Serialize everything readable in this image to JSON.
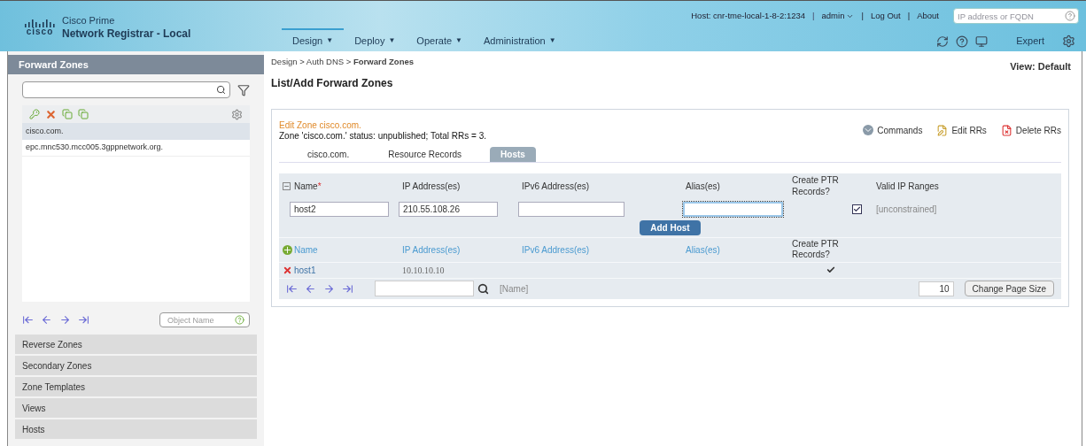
{
  "header": {
    "logo_word": "cisco",
    "product_line": "Cisco Prime",
    "product": "Network Registrar - Local",
    "host": "Host: cnr-tme-local-1-8-2:1234",
    "user": "admin",
    "logout": "Log Out",
    "about": "About",
    "search": {
      "placeholder": "IP address or FQDN"
    },
    "menu": [
      {
        "label": "Design",
        "selected": true
      },
      {
        "label": "Deploy",
        "selected": false
      },
      {
        "label": "Operate",
        "selected": false
      },
      {
        "label": "Administration",
        "selected": false
      }
    ],
    "mode": "Expert",
    "separator": "|",
    "menu_caret": "▼"
  },
  "sidebar": {
    "title": "Forward Zones",
    "zones": [
      {
        "label": "cisco.com.",
        "selected": true
      },
      {
        "label": "epc.mnc530.mcc005.3gppnetwork.org.",
        "selected": false
      }
    ],
    "object_search": {
      "placeholder": "Object Name"
    },
    "sections": [
      "Reverse Zones",
      "Secondary Zones",
      "Zone Templates",
      "Views",
      "Hosts"
    ]
  },
  "main": {
    "breadcrumb": "Design > Auth DNS > **Forward Zones**",
    "page_title": "List/Add Forward Zones",
    "view": "View: Default",
    "edit_title": "Edit Zone cisco.com.",
    "status": "Zone 'cisco.com.' status: unpublished; Total RRs = 3.",
    "actions": [
      "Commands",
      "Edit RRs",
      "Delete RRs"
    ],
    "tabs": [
      {
        "label": "cisco.com.",
        "selected": false
      },
      {
        "label": "Resource Records",
        "selected": false
      },
      {
        "label": "Hosts",
        "selected": true
      }
    ],
    "form": {
      "required_mark": "*",
      "columns": [
        "Name",
        "IP Address(es)",
        "IPv6 Address(es)",
        "Alias(es)",
        "Create PTR Records?",
        "Valid IP Ranges"
      ],
      "name": "host2",
      "ip": "210.55.108.26",
      "alias_focused": true,
      "create_ptr": true,
      "valid_ranges": "[unconstrained]",
      "add_button": "Add Host"
    },
    "list": {
      "columns": [
        "Name",
        "IP Address(es)",
        "IPv6 Address(es)",
        "Alias(es)",
        "Create PTR Records?"
      ],
      "rows": [
        {
          "name": "host1",
          "ip": "10.10.10.10",
          "create_ptr": true
        }
      ],
      "filter_hint": "[Name]",
      "page_size": "10",
      "page_size_button": "Change Page Size"
    }
  }
}
